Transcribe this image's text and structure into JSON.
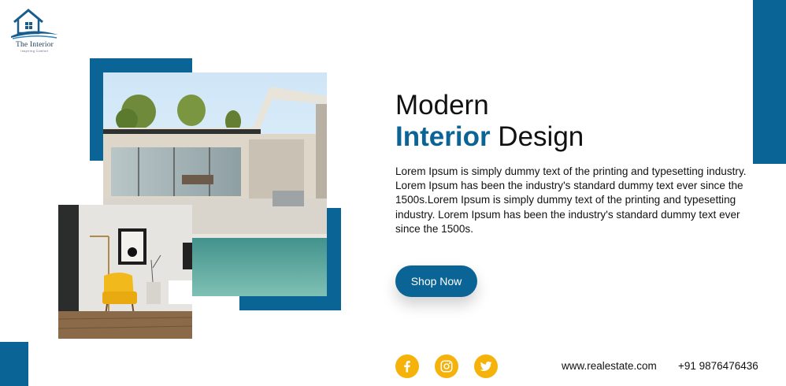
{
  "brand": {
    "name": "The Interior",
    "tagline": "Inspiring Comfort"
  },
  "hero": {
    "title_line1": "Modern",
    "title_highlight": "Interior",
    "title_rest": " Design",
    "description": "Lorem Ipsum is simply dummy text of the printing and typesetting industry. Lorem Ipsum has been the industry's standard dummy text ever since the 1500s.Lorem Ipsum is simply dummy text of the printing and typesetting industry. Lorem Ipsum has been the industry's standard dummy text ever since the 1500s.",
    "cta_label": "Shop Now"
  },
  "social": [
    {
      "icon": "facebook-icon"
    },
    {
      "icon": "instagram-icon"
    },
    {
      "icon": "twitter-icon"
    }
  ],
  "contact": {
    "website": "www.realestate.com",
    "phone": "+91 9876476436"
  },
  "colors": {
    "accent": "#0b6496",
    "social": "#f5b20a",
    "text": "#111111"
  }
}
